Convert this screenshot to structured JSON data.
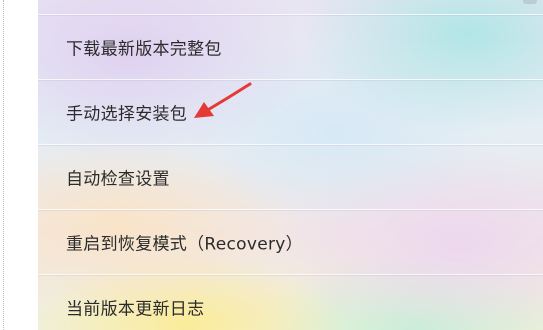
{
  "menu": {
    "items": [
      {
        "label": "下载最新版本完整包"
      },
      {
        "label": "手动选择安装包"
      },
      {
        "label": "自动检查设置"
      },
      {
        "label": "重启到恢复模式（Recovery）"
      },
      {
        "label": "当前版本更新日志"
      }
    ]
  },
  "annotation": {
    "arrow_color": "#e53935",
    "points_to": "手动选择安装包"
  }
}
